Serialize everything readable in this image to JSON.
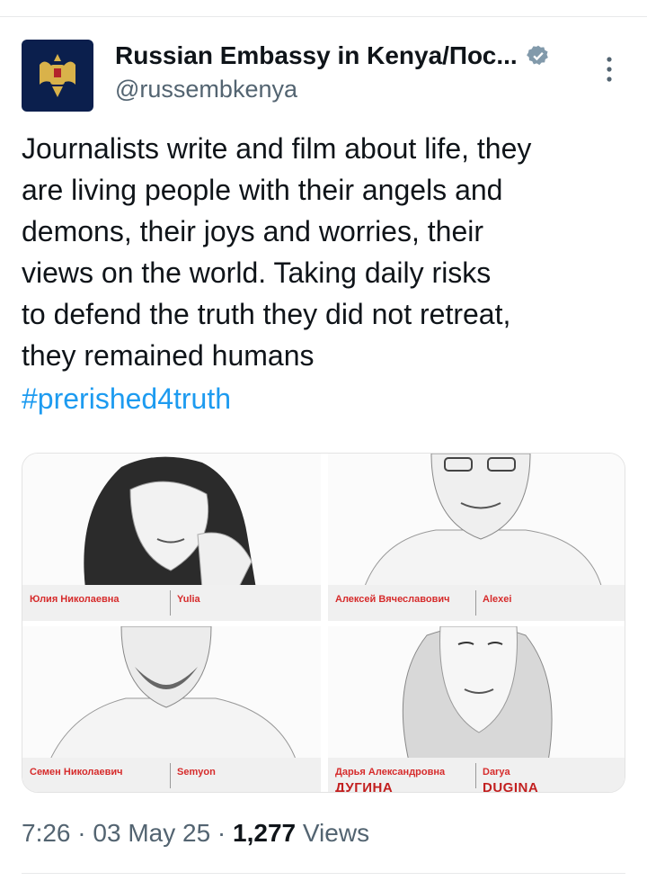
{
  "tweet": {
    "author_name": "Russian Embassy in Kenya/Пос...",
    "author_handle": "@russembkenya",
    "text": "Journalists write and film about life, they\nare living people with their angels and\ndemons, their joys and worries, their\nviews on the world. Taking daily risks\nto defend the truth they did not retreat,\nthey remained humans",
    "hashtag": "#prerished4truth",
    "time": "7:26",
    "date": "03 May 25",
    "views_count": "1,277",
    "views_label": "Views"
  },
  "media": [
    {
      "ru_name": "Юлия Николаевна",
      "en_name": "Yulia",
      "ru_surname": "",
      "en_surname": ""
    },
    {
      "ru_name": "Алексей Вячеславович",
      "en_name": "Alexei",
      "ru_surname": "",
      "en_surname": ""
    },
    {
      "ru_name": "Семен Николаевич",
      "en_name": "Semyon",
      "ru_surname": "",
      "en_surname": ""
    },
    {
      "ru_name": "Дарья Александровна",
      "en_name": "Darya",
      "ru_surname": "ДУГИНА",
      "en_surname": "DUGINA"
    }
  ],
  "colors": {
    "link": "#1d9bf0",
    "verified": "#829aab",
    "caption_red": "#d62b2b"
  },
  "icons": {
    "verified": "verified-badge-icon",
    "more": "more-vertical-icon",
    "avatar": "coat-of-arms-icon"
  }
}
